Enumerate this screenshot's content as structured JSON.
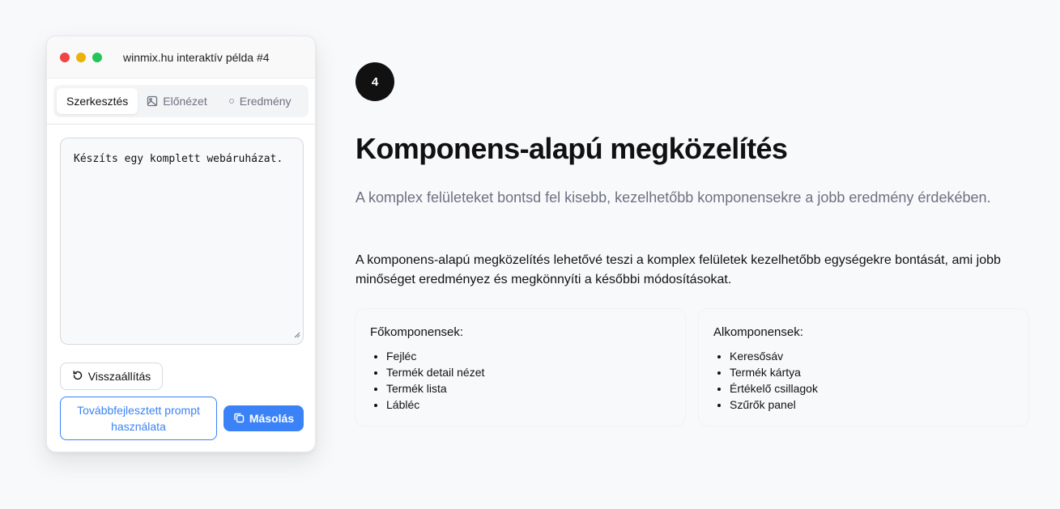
{
  "window": {
    "title": "winmix.hu interaktív példa #4",
    "tabs": [
      {
        "label": "Szerkesztés",
        "icon": "edit",
        "active": true
      },
      {
        "label": "Előnézet",
        "icon": "image-icon",
        "active": false
      },
      {
        "label": "Eredmény",
        "icon": "dot-icon",
        "active": false
      }
    ],
    "editor_value": "Készíts egy komplett webáruházat.",
    "reset_label": "Visszaállítás",
    "advanced_label": "Továbbfejlesztett prompt használata",
    "copy_label": "Másolás"
  },
  "content": {
    "step_number": "4",
    "heading": "Komponens-alapú megközelítés",
    "subtitle": "A komplex felületeket bontsd fel kisebb, kezelhetőbb komponensekre a jobb eredmény érdekében.",
    "body": "A komponens-alapú megközelítés lehetővé teszi a komplex felületek kezelhetőbb egységekre bontását, ami jobb minőséget eredményez és megkönnyíti a későbbi módosításokat.",
    "cards": [
      {
        "title": "Főkomponensek:",
        "items": [
          "Fejléc",
          "Termék detail nézet",
          "Termék lista",
          "Lábléc"
        ]
      },
      {
        "title": "Alkomponensek:",
        "items": [
          "Keresősáv",
          "Termék kártya",
          "Értékelő csillagok",
          "Szűrők panel"
        ]
      }
    ]
  },
  "colors": {
    "accent": "#3b82f6",
    "traffic_red": "#ef4444",
    "traffic_yellow": "#eab308",
    "traffic_green": "#22c55e"
  }
}
